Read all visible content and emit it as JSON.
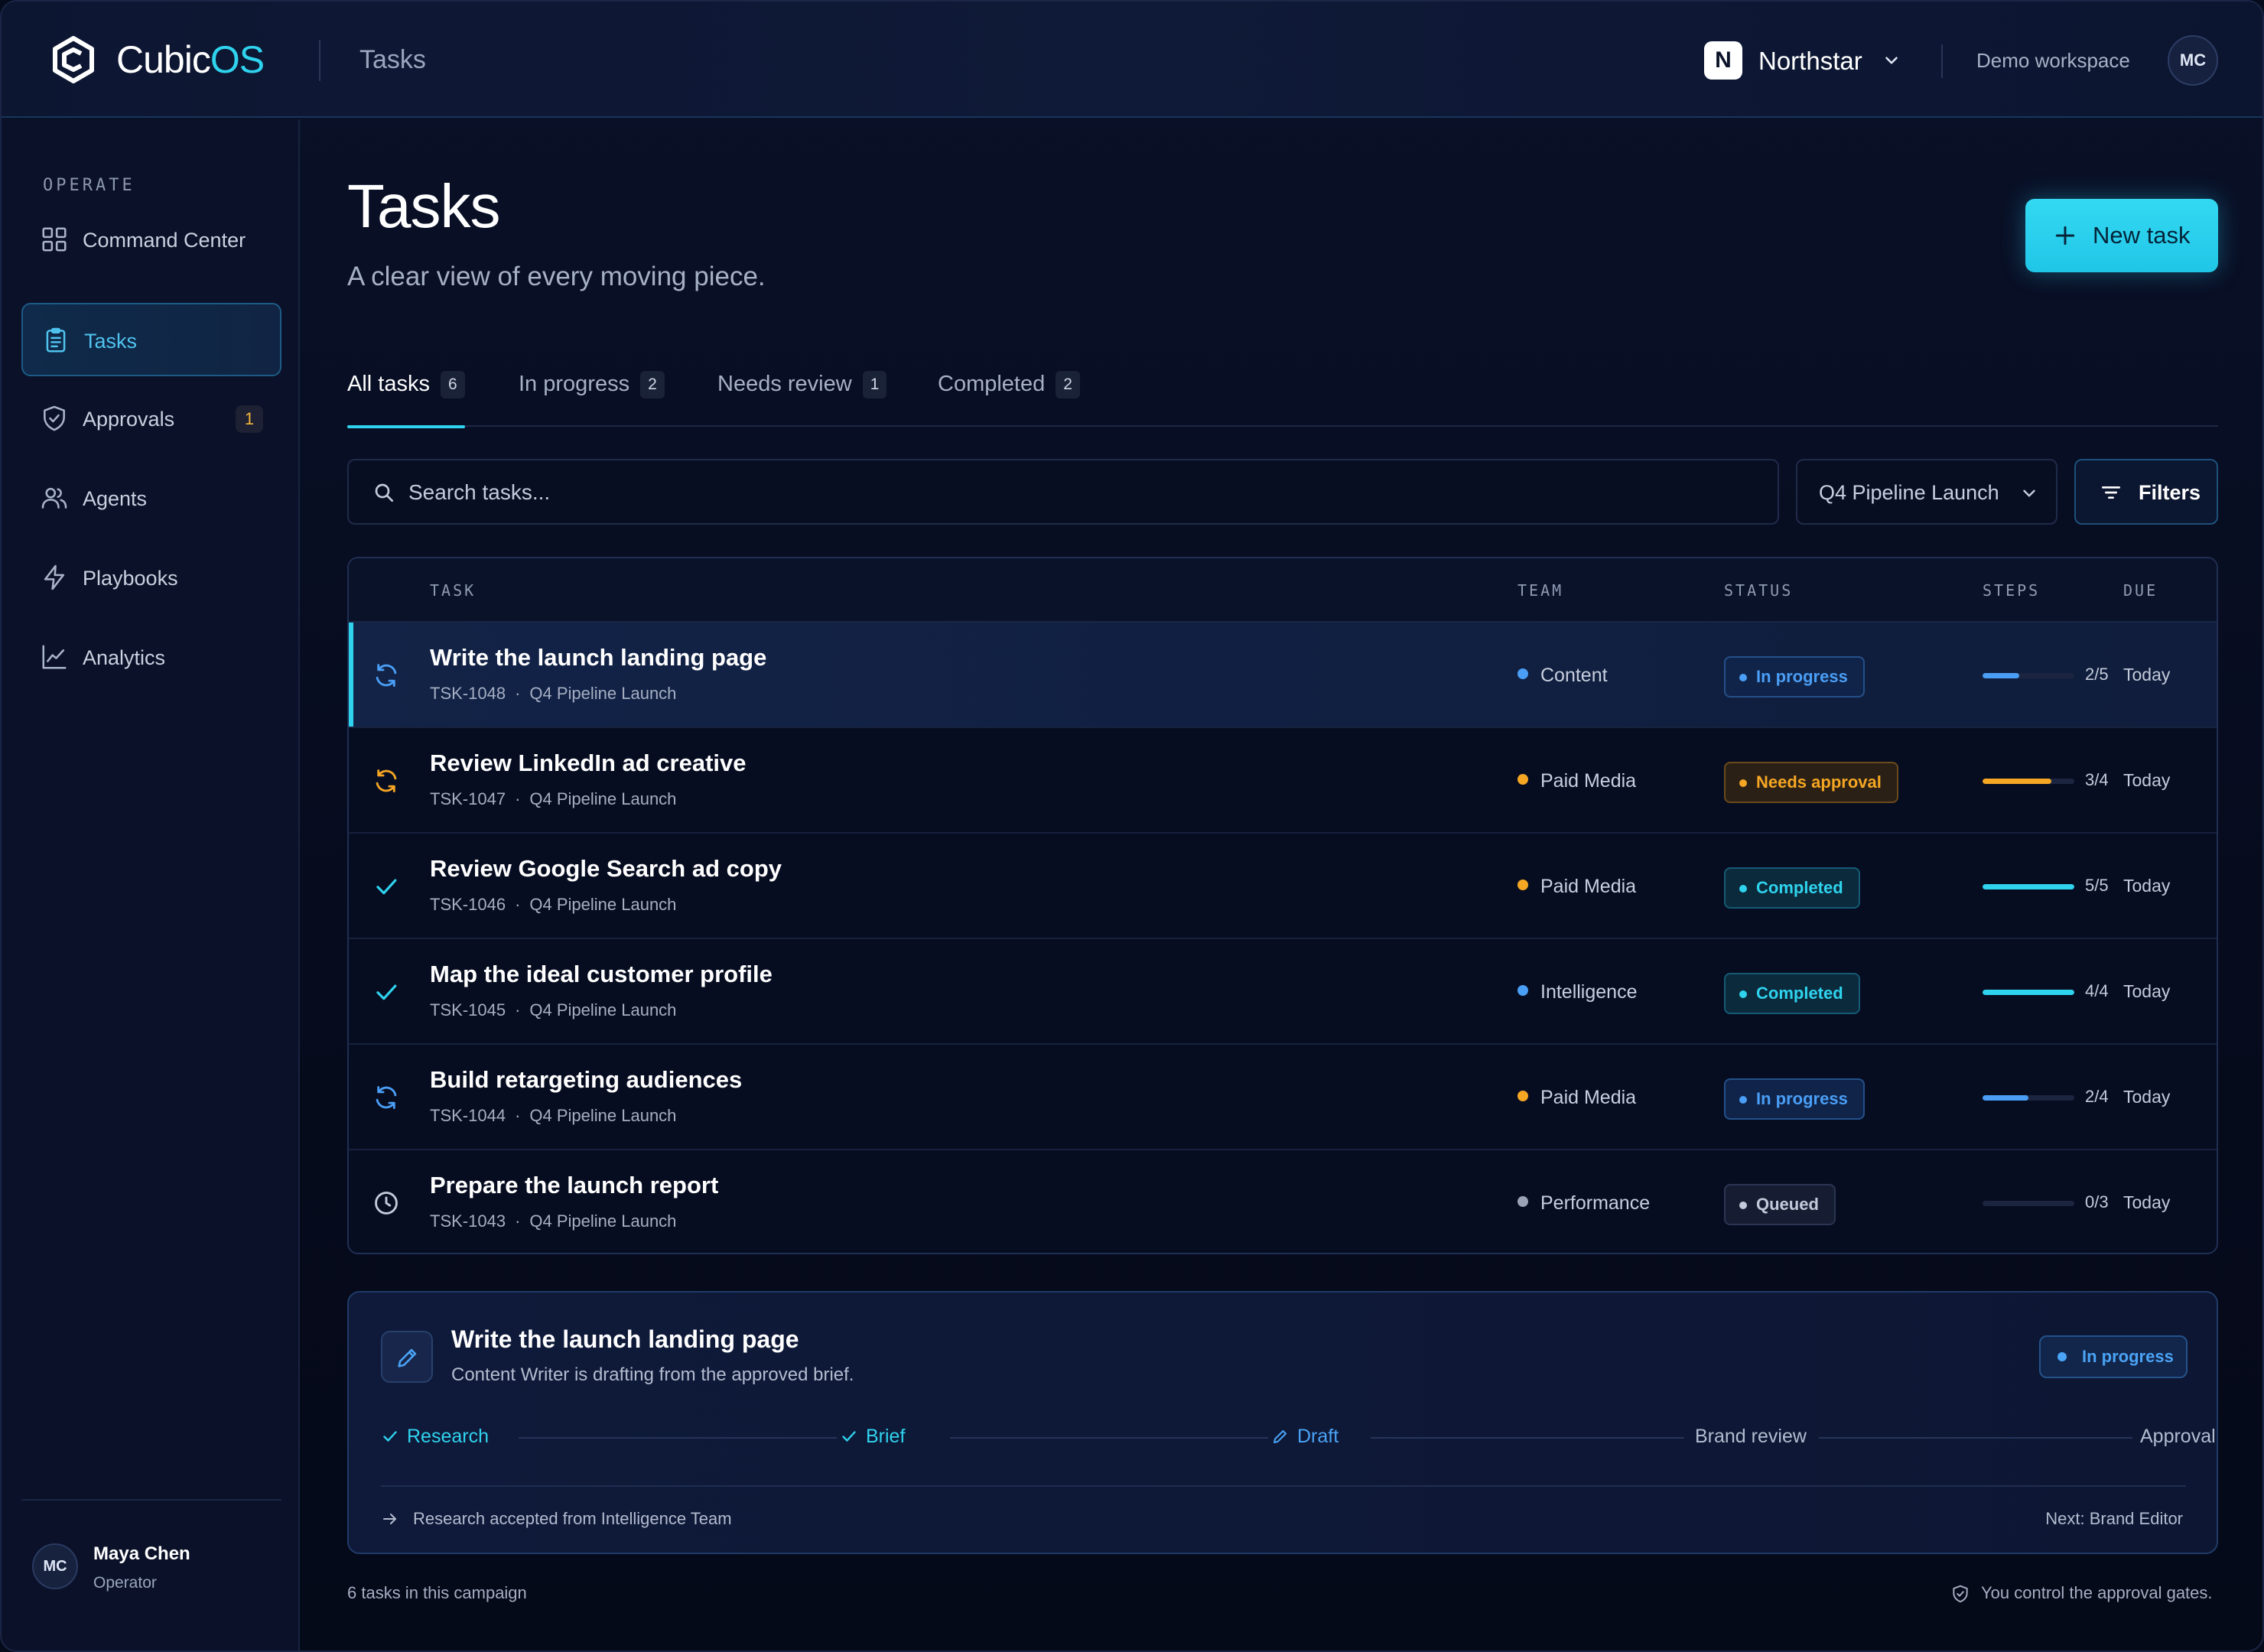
{
  "header": {
    "logo_part1": "Cubic",
    "logo_part2": "OS",
    "page": "Tasks",
    "workspace_badge": "N",
    "workspace_name": "Northstar",
    "demo_label": "Demo workspace",
    "avatar_initials": "MC"
  },
  "sidebar": {
    "section": "OPERATE",
    "items": [
      {
        "label": "Command Center",
        "icon": "grid-icon"
      },
      {
        "label": "Tasks",
        "icon": "clipboard-icon",
        "active": true
      },
      {
        "label": "Approvals",
        "icon": "shield-check-icon",
        "badge": "1"
      },
      {
        "label": "Agents",
        "icon": "users-icon"
      },
      {
        "label": "Playbooks",
        "icon": "bolt-icon"
      },
      {
        "label": "Analytics",
        "icon": "chart-line-icon"
      }
    ],
    "user": {
      "initials": "MC",
      "name": "Maya Chen",
      "role": "Operator"
    }
  },
  "main": {
    "title": "Tasks",
    "subtitle": "A clear view of every moving piece.",
    "new_task_label": "New task",
    "tabs": [
      {
        "label": "All tasks",
        "count": "6"
      },
      {
        "label": "In progress",
        "count": "2"
      },
      {
        "label": "Needs review",
        "count": "1"
      },
      {
        "label": "Completed",
        "count": "2"
      }
    ],
    "search_placeholder": "Search tasks...",
    "campaign_filter": "Q4 Pipeline Launch",
    "filters_label": "Filters"
  },
  "table": {
    "columns": {
      "task": "TASK",
      "team": "TEAM",
      "status": "STATUS",
      "steps": "STEPS",
      "due": "DUE"
    },
    "rows": [
      {
        "title": "Write the launch landing page",
        "id": "TSK-1048",
        "campaign": "Q4 Pipeline Launch",
        "team": "Content",
        "team_color": "#4a9ef5",
        "status": "In progress",
        "status_kind": "progress",
        "steps": "2/5",
        "steps_fraction": 0.4,
        "due": "Today",
        "icon": "sync-icon"
      },
      {
        "title": "Review LinkedIn ad creative",
        "id": "TSK-1047",
        "campaign": "Q4 Pipeline Launch",
        "team": "Paid Media",
        "team_color": "#f5a623",
        "status": "Needs approval",
        "status_kind": "approval",
        "steps": "3/4",
        "steps_fraction": 0.75,
        "due": "Today",
        "icon": "sync-icon"
      },
      {
        "title": "Review Google Search ad copy",
        "id": "TSK-1046",
        "campaign": "Q4 Pipeline Launch",
        "team": "Paid Media",
        "team_color": "#f5a623",
        "status": "Completed",
        "status_kind": "completed",
        "steps": "5/5",
        "steps_fraction": 1.0,
        "due": "Today",
        "icon": "check-icon"
      },
      {
        "title": "Map the ideal customer profile",
        "id": "TSK-1045",
        "campaign": "Q4 Pipeline Launch",
        "team": "Intelligence",
        "team_color": "#4a9ef5",
        "status": "Completed",
        "status_kind": "completed",
        "steps": "4/4",
        "steps_fraction": 1.0,
        "due": "Today",
        "icon": "check-icon"
      },
      {
        "title": "Build retargeting audiences",
        "id": "TSK-1044",
        "campaign": "Q4 Pipeline Launch",
        "team": "Paid Media",
        "team_color": "#f5a623",
        "status": "In progress",
        "status_kind": "progress",
        "steps": "2/4",
        "steps_fraction": 0.5,
        "due": "Today",
        "icon": "sync-icon"
      },
      {
        "title": "Prepare the launch report",
        "id": "TSK-1043",
        "campaign": "Q4 Pipeline Launch",
        "team": "Performance",
        "team_color": "#9aa3b5",
        "status": "Queued",
        "status_kind": "queued",
        "steps": "0/3",
        "steps_fraction": 0.0,
        "due": "Today",
        "icon": "clock-icon"
      }
    ]
  },
  "detail": {
    "title": "Write the launch landing page",
    "subtitle": "Content Writer is drafting from the approved brief.",
    "status": "In progress",
    "stages": [
      {
        "label": "Research",
        "state": "done"
      },
      {
        "label": "Brief",
        "state": "done"
      },
      {
        "label": "Draft",
        "state": "current"
      },
      {
        "label": "Brand review",
        "state": "todo"
      },
      {
        "label": "Approval",
        "state": "todo"
      }
    ],
    "footer_note": "Research accepted from Intelligence Team",
    "next": "Next: Brand Editor"
  },
  "footer": {
    "left": "6 tasks in this campaign",
    "right": "You control the approval gates."
  },
  "colors": {
    "accent": "#2fd3ee",
    "progress": "#4a9ef5",
    "approval": "#f5a623",
    "queued": "#9aa3b5"
  }
}
